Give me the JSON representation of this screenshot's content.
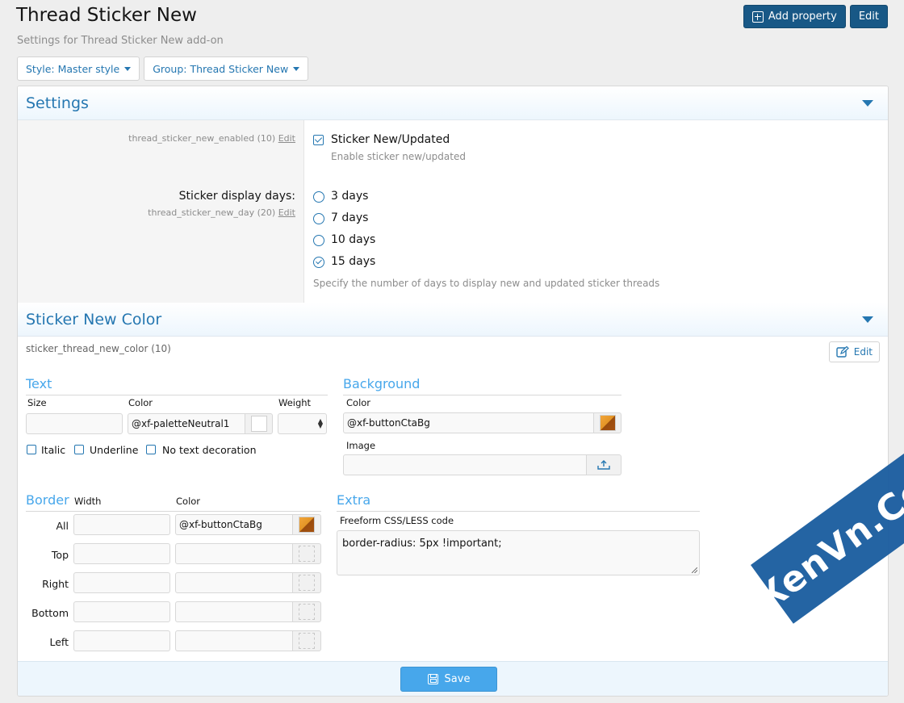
{
  "header": {
    "title": "Thread Sticker New",
    "description": "Settings for Thread Sticker New add-on",
    "add_property_label": "Add property",
    "edit_label": "Edit"
  },
  "filters": {
    "style_label": "Style: Master style",
    "group_label": "Group: Thread Sticker New"
  },
  "settings": {
    "title": "Settings",
    "enabled": {
      "meta": "thread_sticker_new_enabled (10)",
      "edit_link": "Edit",
      "label": "Sticker New/Updated",
      "hint": "Enable sticker new/updated",
      "checked": true
    },
    "display_days": {
      "label": "Sticker display days:",
      "meta": "thread_sticker_new_day (20)",
      "edit_link": "Edit",
      "options": [
        "3 days",
        "7 days",
        "10 days",
        "15 days"
      ],
      "selected": "15 days",
      "hint": "Specify the number of days to display new and updated sticker threads"
    }
  },
  "color_section": {
    "title": "Sticker New Color",
    "meta": "sticker_thread_new_color (10)",
    "edit_label": "Edit",
    "text": {
      "title": "Text",
      "size_label": "Size",
      "size_value": "",
      "color_label": "Color",
      "color_value": "@xf-paletteNeutral1",
      "weight_label": "Weight",
      "italic_label": "Italic",
      "underline_label": "Underline",
      "no_decoration_label": "No text decoration"
    },
    "background": {
      "title": "Background",
      "color_label": "Color",
      "color_value": "@xf-buttonCtaBg",
      "image_label": "Image",
      "image_value": ""
    },
    "border": {
      "title": "Border",
      "width_label": "Width",
      "color_label": "Color",
      "rows": [
        {
          "label": "All",
          "width": "",
          "color": "@xf-buttonCtaBg"
        },
        {
          "label": "Top",
          "width": "",
          "color": ""
        },
        {
          "label": "Right",
          "width": "",
          "color": ""
        },
        {
          "label": "Bottom",
          "width": "",
          "color": ""
        },
        {
          "label": "Left",
          "width": "",
          "color": ""
        }
      ]
    },
    "extra": {
      "title": "Extra",
      "label": "Freeform CSS/LESS code",
      "value": "border-radius: 5px !important;"
    }
  },
  "footer": {
    "save_label": "Save"
  },
  "watermark": "XenVn.Com",
  "colors": {
    "accent": "#2577b1",
    "primary_button": "#185886",
    "save_button": "#47a7eb",
    "subsection_title": "#47a7eb"
  }
}
